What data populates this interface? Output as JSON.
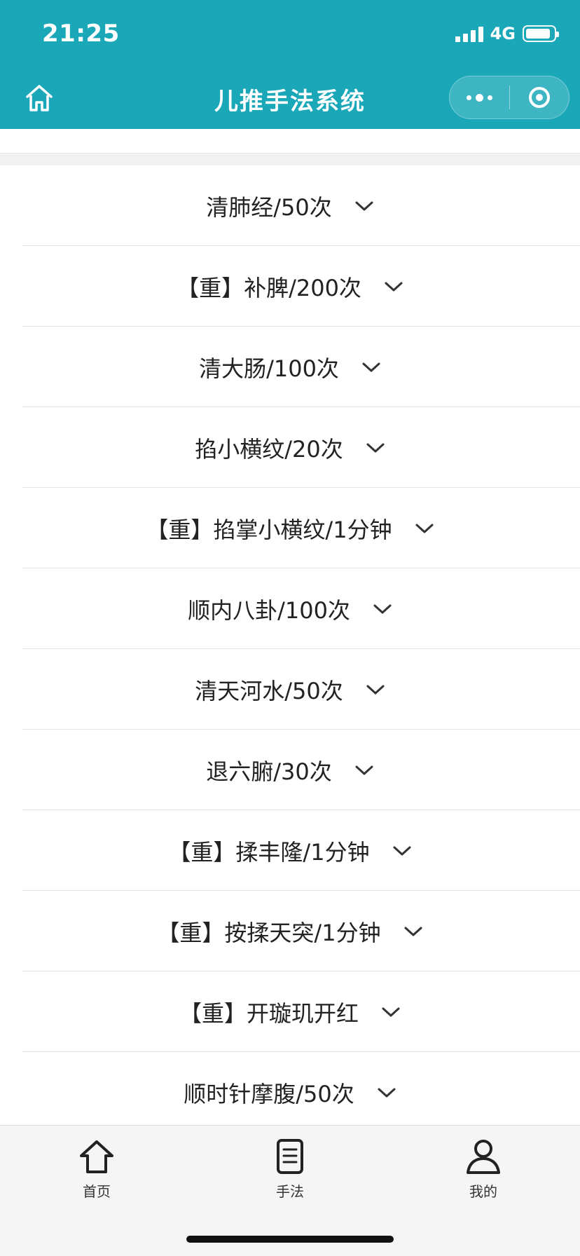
{
  "status_bar": {
    "time": "21:25",
    "network": "4G"
  },
  "header": {
    "title": "儿推手法系统"
  },
  "icons": {
    "home": "home-icon",
    "more": "more-dots-icon",
    "close": "target-icon",
    "chevron": "chevron-down-icon"
  },
  "colors": {
    "header": "#1aa7b8",
    "text": "#222222",
    "divider": "#e6e6e6",
    "tabbar": "#f5f5f5"
  },
  "list": {
    "items": [
      {
        "label": "清肺经/50次"
      },
      {
        "label": "【重】补脾/200次"
      },
      {
        "label": "清大肠/100次"
      },
      {
        "label": "掐小横纹/20次"
      },
      {
        "label": "【重】掐掌小横纹/1分钟"
      },
      {
        "label": "顺内八卦/100次"
      },
      {
        "label": "清天河水/50次"
      },
      {
        "label": "退六腑/30次"
      },
      {
        "label": "【重】揉丰隆/1分钟"
      },
      {
        "label": "【重】按揉天突/1分钟"
      },
      {
        "label": "【重】开璇玑开红"
      },
      {
        "label": "顺时针摩腹/50次"
      }
    ]
  },
  "tabbar": {
    "items": [
      {
        "label": "首页"
      },
      {
        "label": "手法"
      },
      {
        "label": "我的"
      }
    ]
  }
}
